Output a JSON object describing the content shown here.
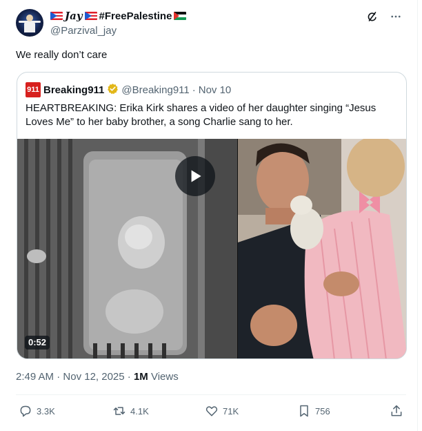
{
  "author": {
    "display_name_part": "Jay",
    "hashtag": "#FreePalestine",
    "handle": "@Parzival_jay"
  },
  "tweet": {
    "text": "We really don’t care"
  },
  "quote": {
    "logo_text": "911",
    "name": "Breaking911",
    "handle": "@Breaking911",
    "separator": "·",
    "date": "Nov 10",
    "text": "HEARTBREAKING: Erika Kirk shares a video of her daughter singing “Jesus Loves Me” to her baby brother, a song Charlie sang to her.",
    "video_duration": "0:52"
  },
  "meta": {
    "time": "2:49 AM",
    "separator": "·",
    "date": "Nov 12, 2025",
    "separator2": "·",
    "views_count": "1M",
    "views_label": "Views"
  },
  "actions": {
    "replies": "3.3K",
    "reposts": "4.1K",
    "likes": "71K",
    "bookmarks": "756"
  },
  "icons": {
    "grok": "grok-icon",
    "more": "more-icon",
    "verified": "verified-badge-icon",
    "play": "play-icon",
    "reply": "reply-icon",
    "repost": "repost-icon",
    "like": "like-icon",
    "bookmark": "bookmark-icon",
    "share": "share-icon"
  },
  "colors": {
    "text_primary": "#0f1419",
    "text_secondary": "#536471",
    "border": "#cfd9de",
    "verified_gold": "#e2b719",
    "breaking_red": "#d7201e"
  }
}
